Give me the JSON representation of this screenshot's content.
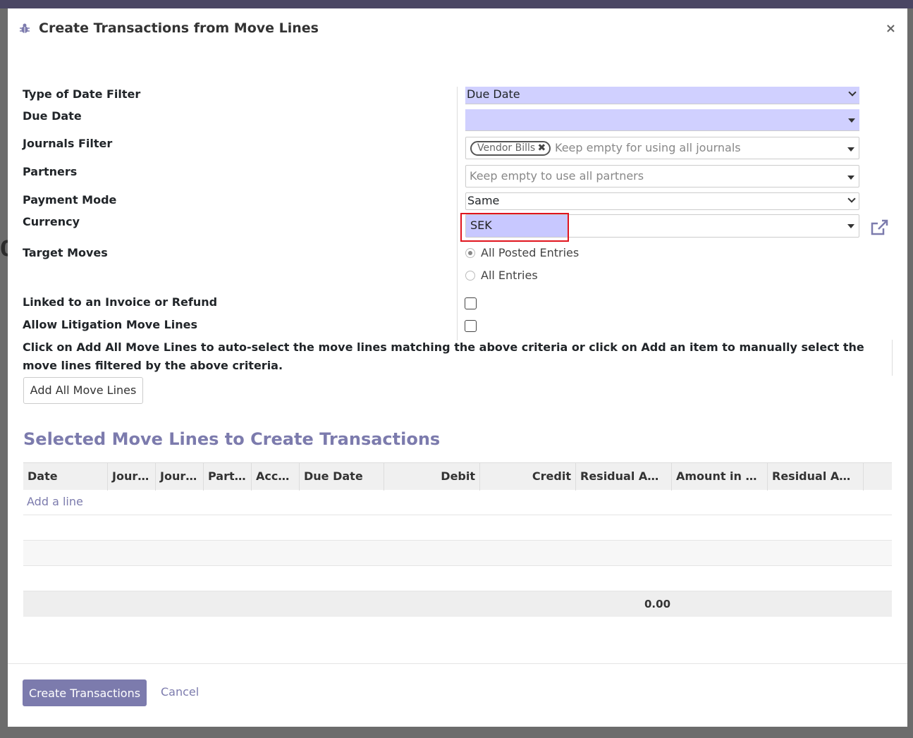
{
  "dialog": {
    "title": "Create Transactions from Move Lines",
    "close_symbol": "×"
  },
  "form": {
    "type_of_date_filter": {
      "label": "Type of Date Filter",
      "value": "Due Date"
    },
    "due_date": {
      "label": "Due Date",
      "value": ""
    },
    "journals_filter": {
      "label": "Journals Filter",
      "tag": "Vendor Bills",
      "tag_remove": "✖",
      "placeholder": "Keep empty for using all journals"
    },
    "partners": {
      "label": "Partners",
      "placeholder": "Keep empty to use all partners"
    },
    "payment_mode": {
      "label": "Payment Mode",
      "value": "Same"
    },
    "currency": {
      "label": "Currency",
      "value": "SEK"
    },
    "target_moves": {
      "label": "Target Moves",
      "options": [
        "All Posted Entries",
        "All Entries"
      ],
      "selected": "All Posted Entries"
    },
    "linked_invoice": {
      "label": "Linked to an Invoice or Refund",
      "checked": false
    },
    "allow_litigation": {
      "label": "Allow Litigation Move Lines",
      "checked": false
    }
  },
  "help_text": "Click on Add All Move Lines to auto-select the move lines matching the above criteria or click on Add an item to manually select the move lines filtered by the above criteria.",
  "add_all_button": "Add All Move Lines",
  "section_title": "Selected Move Lines to Create Transactions",
  "table": {
    "columns": [
      "Date",
      "Jour…",
      "Jour…",
      "Part…",
      "Acc…",
      "Due Date",
      "Debit",
      "Credit",
      "Residual Am…",
      "Amount in C…",
      "Residual Am…"
    ],
    "add_line": "Add a line",
    "total_debit": "0.00"
  },
  "footer": {
    "primary_button": "Create Transactions",
    "cancel_button": "Cancel"
  },
  "colors": {
    "accent": "#7c7bad",
    "highlight_field": "#d0d0ff",
    "annotation_box": "#e0141e"
  }
}
